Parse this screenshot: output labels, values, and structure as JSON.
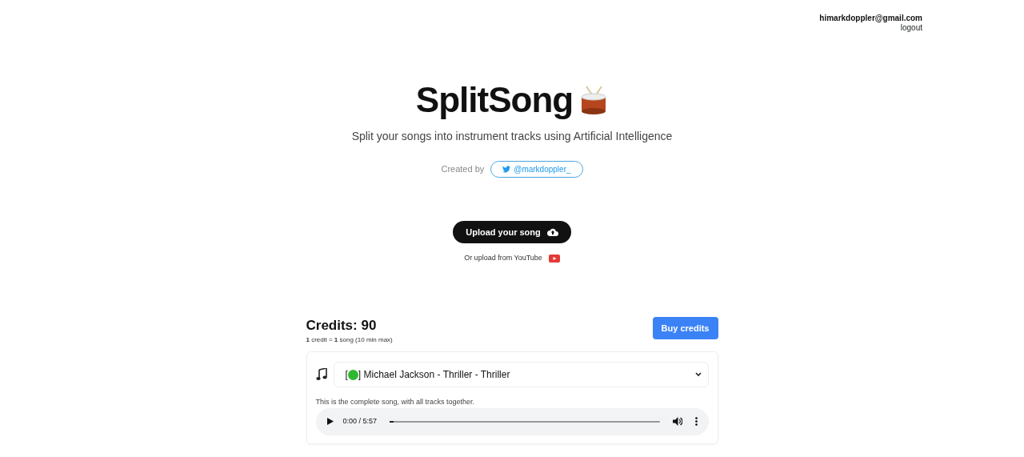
{
  "user": {
    "email": "himarkdoppler@gmail.com",
    "logout": "logout"
  },
  "hero": {
    "title": "SplitSong",
    "subtitle": "Split your songs into instrument tracks using Artificial Intelligence",
    "created_by": "Created by",
    "twitter": "@markdoppler_"
  },
  "upload": {
    "button": "Upload your song",
    "youtube": "Or upload from YouTube"
  },
  "credits": {
    "title": "Credits: 90",
    "note": "**1** credit = **1** song (10 min max)",
    "buy": "Buy credits"
  },
  "track": {
    "select": {
      "open": "[",
      "color": "#2fb82f",
      "label": "] Michael Jackson - Thriller - Thriller"
    },
    "description": "This is the complete song, with all tracks together.",
    "player": {
      "time": "0:00 / 5:57",
      "level": 0.01
    }
  }
}
